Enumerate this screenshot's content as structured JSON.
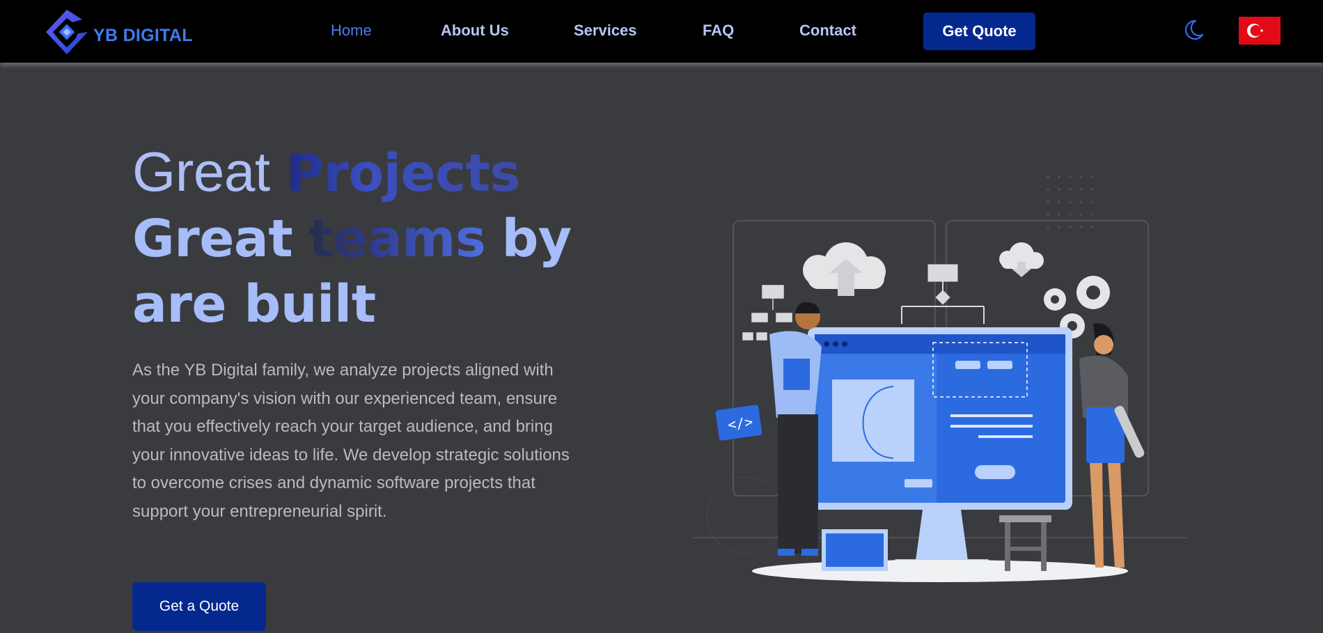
{
  "brand": {
    "name": "YB DIGITAL",
    "logo_icon": "diamond-logo-icon",
    "accent_color": "#3d7cf0"
  },
  "nav": {
    "items": [
      {
        "label": "Home",
        "active": true
      },
      {
        "label": "About Us",
        "active": false
      },
      {
        "label": "Services",
        "active": false
      },
      {
        "label": "FAQ",
        "active": false
      },
      {
        "label": "Contact",
        "active": false
      }
    ],
    "quote_button": "Get Quote",
    "theme_toggle_icon": "moon-icon",
    "language_flag_icon": "turkey-flag-icon"
  },
  "hero": {
    "title": {
      "word1": "Great",
      "word2": "Projects",
      "word3": "Great",
      "word4": "teams",
      "word5": "by",
      "line3": "are built"
    },
    "description": "As the YB Digital family, we analyze projects aligned with your company's vision with our experienced team, ensure that you effectively reach your target audience, and bring your innovative ideas to life. We develop strategic solutions to overcome crises and dynamic software projects that support your entrepreneurial spirit.",
    "cta": "Get a Quote",
    "illustration": "web-development-team-illustration",
    "button_color": "#05288f"
  }
}
